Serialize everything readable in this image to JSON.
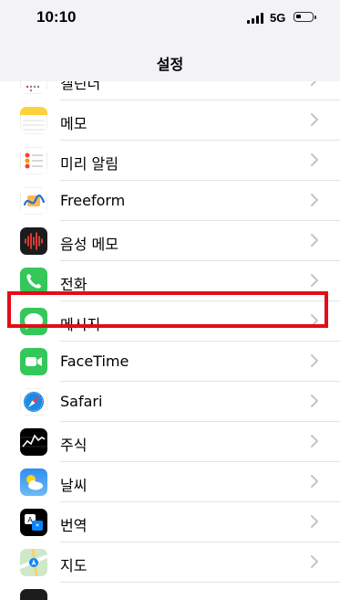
{
  "status": {
    "time": "10:10",
    "network": "5G"
  },
  "nav": {
    "title": "설정"
  },
  "rows": [
    {
      "label": "캘린더",
      "icon": "calendar-icon"
    },
    {
      "label": "메모",
      "icon": "notes-icon"
    },
    {
      "label": "미리 알림",
      "icon": "reminders-icon"
    },
    {
      "label": "Freeform",
      "icon": "freeform-icon"
    },
    {
      "label": "음성 메모",
      "icon": "voice-memos-icon"
    },
    {
      "label": "전화",
      "icon": "phone-icon"
    },
    {
      "label": "메시지",
      "icon": "messages-icon"
    },
    {
      "label": "FaceTime",
      "icon": "facetime-icon"
    },
    {
      "label": "Safari",
      "icon": "safari-icon",
      "highlighted": true
    },
    {
      "label": "주식",
      "icon": "stocks-icon"
    },
    {
      "label": "날씨",
      "icon": "weather-icon"
    },
    {
      "label": "번역",
      "icon": "translate-icon"
    },
    {
      "label": "지도",
      "icon": "maps-icon"
    }
  ],
  "colors": {
    "highlight": "#e30c17",
    "background": "#f2f2f7",
    "chevron": "#c4c4c7"
  }
}
